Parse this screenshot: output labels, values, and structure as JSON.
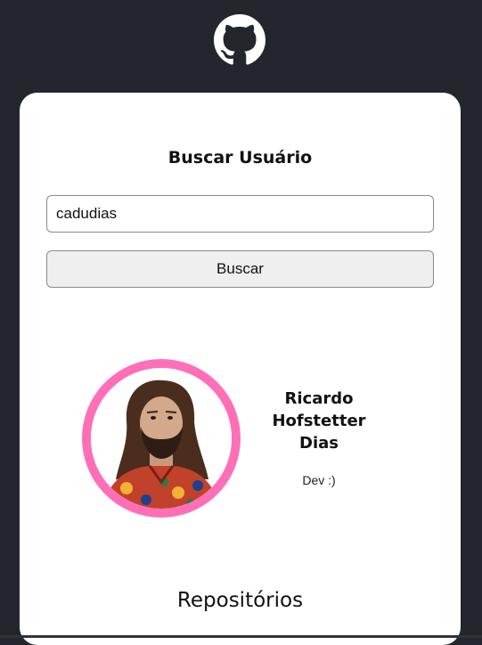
{
  "header": {
    "logo_icon": "github-octocat-icon"
  },
  "search": {
    "title": "Buscar Usuário",
    "input_value": "cadudias",
    "button_label": "Buscar"
  },
  "profile": {
    "name": "Ricardo Hofstetter Dias",
    "bio": "Dev :)",
    "avatar_border_color": "#ff6fb7"
  },
  "repositories": {
    "title": "Repositórios"
  },
  "colors": {
    "background": "#23272d",
    "card": "#ffffff",
    "accent": "#ff6fb7"
  }
}
